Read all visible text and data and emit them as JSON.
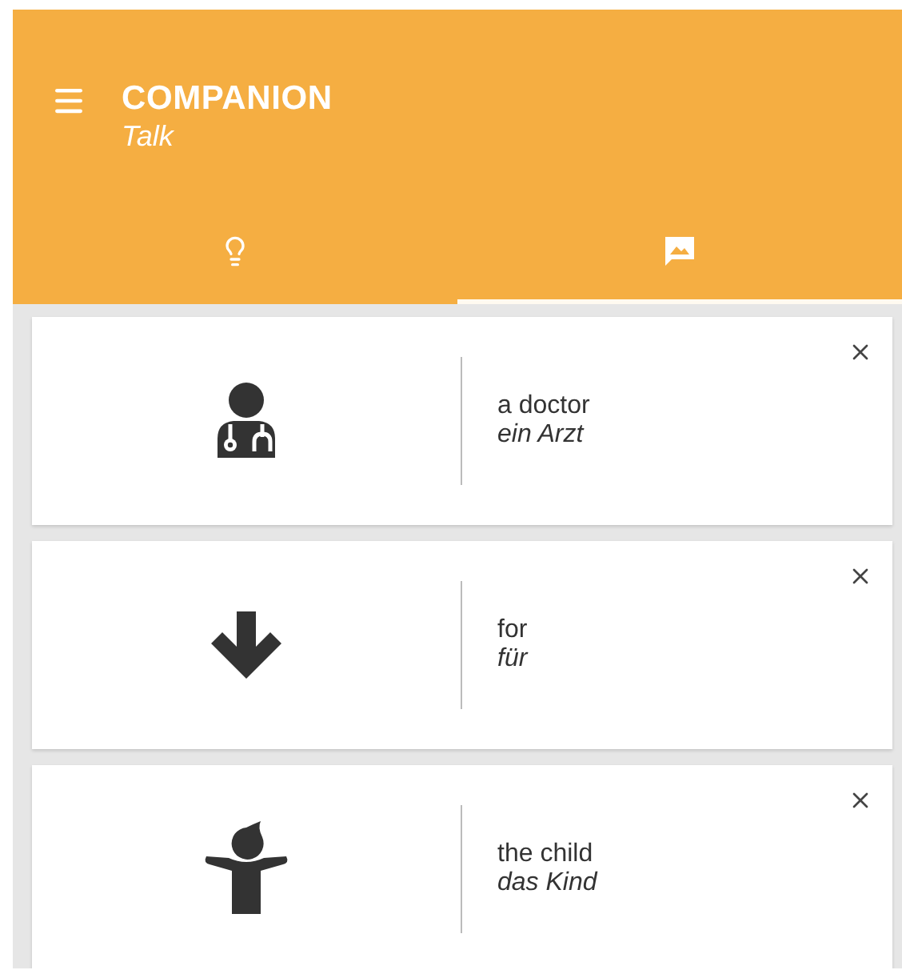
{
  "app_bar": {
    "title": "COMPANION",
    "subtitle": "Talk"
  },
  "tabs": [
    {
      "kind": "idea",
      "selected": false
    },
    {
      "kind": "image",
      "selected": true
    }
  ],
  "cards": [
    {
      "kind": "doctor",
      "english": "a doctor",
      "german": "ein Arzt"
    },
    {
      "kind": "arrow",
      "english": "for",
      "german": "für"
    },
    {
      "kind": "child",
      "english": "the child",
      "german": "das Kind"
    }
  ]
}
